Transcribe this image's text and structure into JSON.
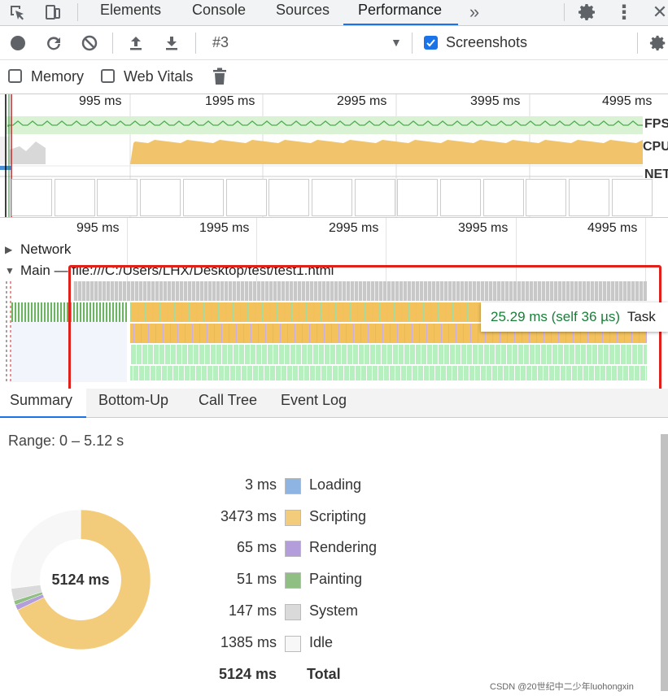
{
  "tabs": {
    "elements": "Elements",
    "console": "Console",
    "sources": "Sources",
    "performance": "Performance"
  },
  "toolbar": {
    "profile_select": "#3",
    "screenshots_label": "Screenshots",
    "memory_label": "Memory",
    "webvitals_label": "Web Vitals"
  },
  "overview": {
    "ticks": [
      "995 ms",
      "1995 ms",
      "2995 ms",
      "3995 ms",
      "4995 ms"
    ],
    "fps_label": "FPS",
    "cpu_label": "CPU",
    "net_label": "NET"
  },
  "flamechart": {
    "ticks": [
      "995 ms",
      "1995 ms",
      "2995 ms",
      "3995 ms",
      "4995 ms"
    ],
    "network_label": "Network",
    "main_label": "Main — file:///C:/Users/LHX/Desktop/test/test1.html"
  },
  "tooltip": {
    "time": "25.29 ms (self 36 µs)",
    "name": "Task"
  },
  "bottom_tabs": {
    "summary": "Summary",
    "bottom_up": "Bottom-Up",
    "call_tree": "Call Tree",
    "event_log": "Event Log"
  },
  "summary": {
    "range": "Range: 0 – 5.12 s",
    "donut_total": "5124 ms",
    "items": [
      {
        "value": "3 ms",
        "name": "Loading",
        "color": "#8db4e2"
      },
      {
        "value": "3473 ms",
        "name": "Scripting",
        "color": "#f3cc7b"
      },
      {
        "value": "65 ms",
        "name": "Rendering",
        "color": "#b39ddb"
      },
      {
        "value": "51 ms",
        "name": "Painting",
        "color": "#8fbf83"
      },
      {
        "value": "147 ms",
        "name": "System",
        "color": "#dadada"
      },
      {
        "value": "1385 ms",
        "name": "Idle",
        "color": "#f7f7f7"
      }
    ],
    "total_value": "5124 ms",
    "total_label": "Total"
  },
  "watermark": "CSDN @20世纪中二少年luohongxin"
}
